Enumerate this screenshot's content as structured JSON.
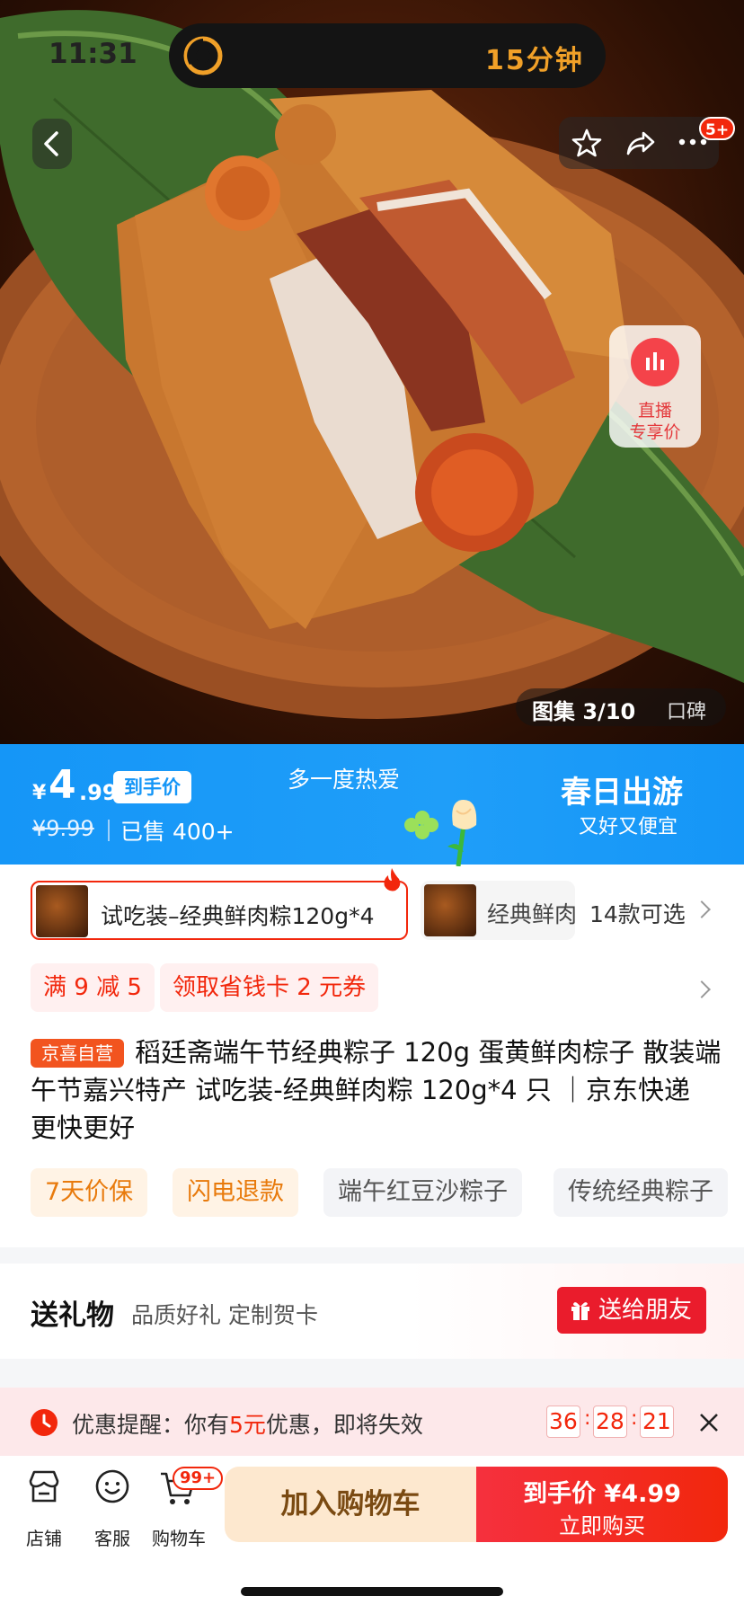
{
  "status_bar": {
    "time": "11:31",
    "timer_text": "15分钟",
    "timer_color": "#f0a028"
  },
  "hero": {
    "gallery_label": "图集 3/10",
    "reviews_label": "口碑",
    "live_line1": "直播",
    "live_line2": "专享价",
    "more_badge": "5+"
  },
  "price_banner": {
    "currency": "¥",
    "price_int": "4",
    "price_dec": ".99",
    "price_tag": "到手价",
    "original_price": "¥9.99",
    "sold": "已售 400+",
    "center_slogan": "多一度热爱",
    "promo_title": "春日出游",
    "promo_sub": "又好又便宜",
    "bg_color": "#1596f7"
  },
  "variants": {
    "selected": "试吃装–经典鲜肉粽120g*4",
    "second": "经典鲜肉",
    "count": "14款可选"
  },
  "coupons": [
    "满 9 减 5",
    "领取省钱卡 2 元券"
  ],
  "product": {
    "badge": "京喜自营",
    "title": "稻廷斋端午节经典粽子 120g 蛋黄鲜肉棕子 散装端午节嘉兴特产 试吃装-经典鲜肉粽 120g*4 只 ｜京东快递 更快更好"
  },
  "tags": [
    "7天价保",
    "闪电退款",
    "端午红豆沙粽子",
    "传统经典粽子"
  ],
  "gift": {
    "title": "送礼物",
    "subtitle": "品质好礼 定制贺卡",
    "button": "送给朋友"
  },
  "reminder": {
    "prefix": "优惠提醒：你有",
    "amount": "5元",
    "suffix": "优惠，即将失效",
    "hours": "36",
    "minutes": "28",
    "seconds": "21"
  },
  "bottom_bar": {
    "store": "店铺",
    "service": "客服",
    "cart": "购物车",
    "cart_badge": "99+",
    "add_cart": "加入购物车",
    "buy_line1": "到手价 ¥4.99",
    "buy_line2": "立即购买",
    "accent": "#f2270c"
  }
}
